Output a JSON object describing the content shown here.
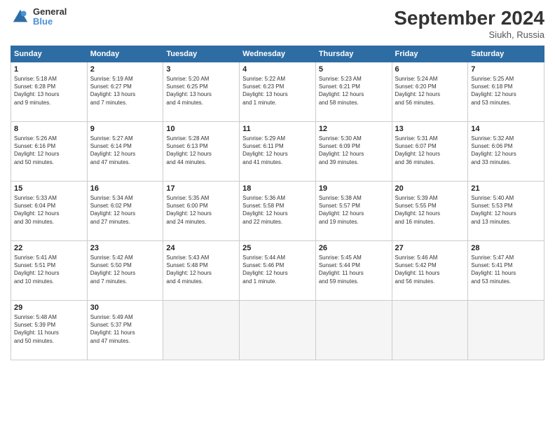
{
  "header": {
    "logo_text_general": "General",
    "logo_text_blue": "Blue",
    "title": "September 2024",
    "location": "Siukh, Russia"
  },
  "weekdays": [
    "Sunday",
    "Monday",
    "Tuesday",
    "Wednesday",
    "Thursday",
    "Friday",
    "Saturday"
  ],
  "weeks": [
    [
      {
        "day": 1,
        "info": "Sunrise: 5:18 AM\nSunset: 6:28 PM\nDaylight: 13 hours\nand 9 minutes."
      },
      {
        "day": 2,
        "info": "Sunrise: 5:19 AM\nSunset: 6:27 PM\nDaylight: 13 hours\nand 7 minutes."
      },
      {
        "day": 3,
        "info": "Sunrise: 5:20 AM\nSunset: 6:25 PM\nDaylight: 13 hours\nand 4 minutes."
      },
      {
        "day": 4,
        "info": "Sunrise: 5:22 AM\nSunset: 6:23 PM\nDaylight: 13 hours\nand 1 minute."
      },
      {
        "day": 5,
        "info": "Sunrise: 5:23 AM\nSunset: 6:21 PM\nDaylight: 12 hours\nand 58 minutes."
      },
      {
        "day": 6,
        "info": "Sunrise: 5:24 AM\nSunset: 6:20 PM\nDaylight: 12 hours\nand 56 minutes."
      },
      {
        "day": 7,
        "info": "Sunrise: 5:25 AM\nSunset: 6:18 PM\nDaylight: 12 hours\nand 53 minutes."
      }
    ],
    [
      {
        "day": 8,
        "info": "Sunrise: 5:26 AM\nSunset: 6:16 PM\nDaylight: 12 hours\nand 50 minutes."
      },
      {
        "day": 9,
        "info": "Sunrise: 5:27 AM\nSunset: 6:14 PM\nDaylight: 12 hours\nand 47 minutes."
      },
      {
        "day": 10,
        "info": "Sunrise: 5:28 AM\nSunset: 6:13 PM\nDaylight: 12 hours\nand 44 minutes."
      },
      {
        "day": 11,
        "info": "Sunrise: 5:29 AM\nSunset: 6:11 PM\nDaylight: 12 hours\nand 41 minutes."
      },
      {
        "day": 12,
        "info": "Sunrise: 5:30 AM\nSunset: 6:09 PM\nDaylight: 12 hours\nand 39 minutes."
      },
      {
        "day": 13,
        "info": "Sunrise: 5:31 AM\nSunset: 6:07 PM\nDaylight: 12 hours\nand 36 minutes."
      },
      {
        "day": 14,
        "info": "Sunrise: 5:32 AM\nSunset: 6:06 PM\nDaylight: 12 hours\nand 33 minutes."
      }
    ],
    [
      {
        "day": 15,
        "info": "Sunrise: 5:33 AM\nSunset: 6:04 PM\nDaylight: 12 hours\nand 30 minutes."
      },
      {
        "day": 16,
        "info": "Sunrise: 5:34 AM\nSunset: 6:02 PM\nDaylight: 12 hours\nand 27 minutes."
      },
      {
        "day": 17,
        "info": "Sunrise: 5:35 AM\nSunset: 6:00 PM\nDaylight: 12 hours\nand 24 minutes."
      },
      {
        "day": 18,
        "info": "Sunrise: 5:36 AM\nSunset: 5:58 PM\nDaylight: 12 hours\nand 22 minutes."
      },
      {
        "day": 19,
        "info": "Sunrise: 5:38 AM\nSunset: 5:57 PM\nDaylight: 12 hours\nand 19 minutes."
      },
      {
        "day": 20,
        "info": "Sunrise: 5:39 AM\nSunset: 5:55 PM\nDaylight: 12 hours\nand 16 minutes."
      },
      {
        "day": 21,
        "info": "Sunrise: 5:40 AM\nSunset: 5:53 PM\nDaylight: 12 hours\nand 13 minutes."
      }
    ],
    [
      {
        "day": 22,
        "info": "Sunrise: 5:41 AM\nSunset: 5:51 PM\nDaylight: 12 hours\nand 10 minutes."
      },
      {
        "day": 23,
        "info": "Sunrise: 5:42 AM\nSunset: 5:50 PM\nDaylight: 12 hours\nand 7 minutes."
      },
      {
        "day": 24,
        "info": "Sunrise: 5:43 AM\nSunset: 5:48 PM\nDaylight: 12 hours\nand 4 minutes."
      },
      {
        "day": 25,
        "info": "Sunrise: 5:44 AM\nSunset: 5:46 PM\nDaylight: 12 hours\nand 1 minute."
      },
      {
        "day": 26,
        "info": "Sunrise: 5:45 AM\nSunset: 5:44 PM\nDaylight: 11 hours\nand 59 minutes."
      },
      {
        "day": 27,
        "info": "Sunrise: 5:46 AM\nSunset: 5:42 PM\nDaylight: 11 hours\nand 56 minutes."
      },
      {
        "day": 28,
        "info": "Sunrise: 5:47 AM\nSunset: 5:41 PM\nDaylight: 11 hours\nand 53 minutes."
      }
    ],
    [
      {
        "day": 29,
        "info": "Sunrise: 5:48 AM\nSunset: 5:39 PM\nDaylight: 11 hours\nand 50 minutes."
      },
      {
        "day": 30,
        "info": "Sunrise: 5:49 AM\nSunset: 5:37 PM\nDaylight: 11 hours\nand 47 minutes."
      },
      null,
      null,
      null,
      null,
      null
    ]
  ]
}
